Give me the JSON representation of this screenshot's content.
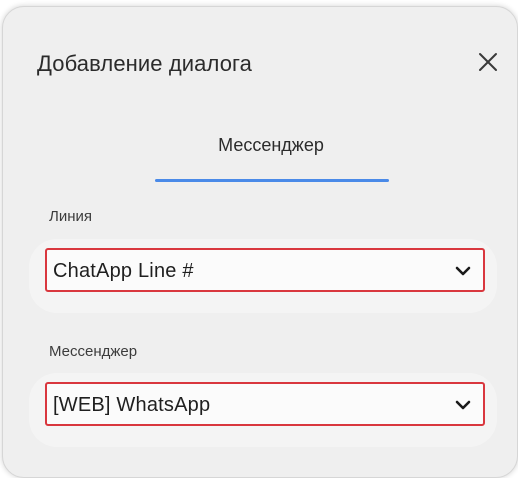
{
  "dialog": {
    "title": "Добавление диалога",
    "close_icon": "close-icon"
  },
  "tabs": [
    {
      "label": "Мессенджер",
      "active": true
    }
  ],
  "fields": {
    "line": {
      "label": "Линия",
      "value": "ChatApp Line #"
    },
    "messenger": {
      "label": "Мессенджер",
      "value": "[WEB] WhatsApp"
    }
  },
  "colors": {
    "accent": "#4a8ae8",
    "highlight_border": "#d9373e",
    "dialog_bg": "#efefef"
  }
}
